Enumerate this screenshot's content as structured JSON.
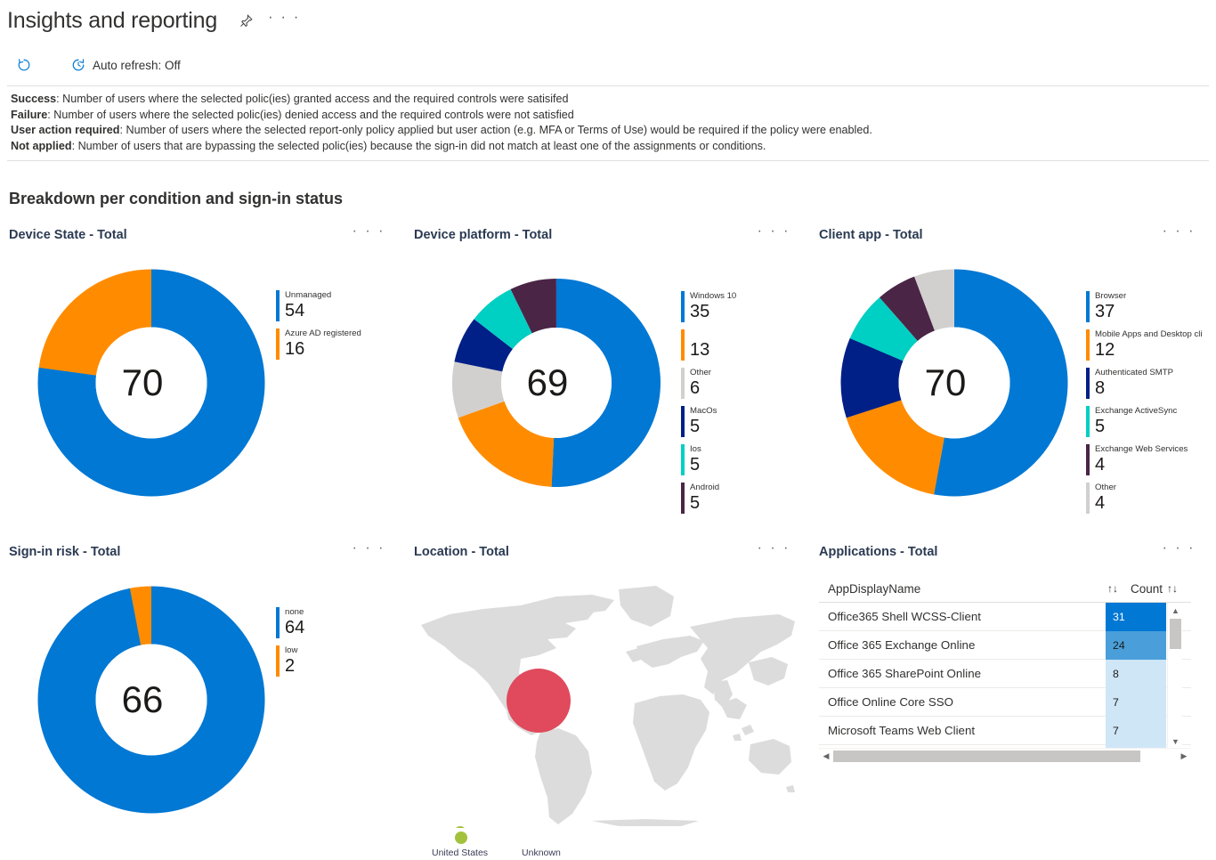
{
  "header": {
    "title": "Insights and reporting",
    "pin_icon": "pin-icon",
    "more_icon": "ellipsis-icon"
  },
  "commandbar": {
    "refresh_label": "",
    "refresh_icon": "refresh-icon",
    "auto_refresh_icon": "history-clock-icon",
    "auto_refresh_label": "Auto refresh: Off"
  },
  "description": [
    {
      "term": "Success",
      "text": ": Number of users where the selected polic(ies) granted access and the required controls were satisifed"
    },
    {
      "term": "Failure",
      "text": ": Number of users where the selected polic(ies) denied access and the required controls were not satisfied"
    },
    {
      "term": "User action required",
      "text": ": Number of users where the selected report-only policy applied but user action (e.g. MFA or Terms of Use) would be required if the policy were enabled."
    },
    {
      "term": "Not applied",
      "text": ": Number of users that are bypassing the selected polic(ies) because the sign-in did not match at least one of the assignments or conditions."
    }
  ],
  "section_heading": "Breakdown per condition and sign-in status",
  "more_menu_glyph": "· · ·",
  "chart_data": [
    {
      "type": "pie",
      "title": "Device State - Total",
      "center_total": "70",
      "legend_position": "right",
      "categories": [
        "Unmanaged",
        "Azure AD registered"
      ],
      "values": [
        54,
        16
      ],
      "colors": [
        "#0078d4",
        "#ff8c00"
      ],
      "labels": [
        "Unmanaged",
        "Azure AD registered"
      ]
    },
    {
      "type": "pie",
      "title": "Device platform - Total",
      "center_total": "69",
      "legend_position": "right",
      "categories": [
        "Windows 10",
        "",
        "Other",
        "MacOs",
        "Ios",
        "Android"
      ],
      "values": [
        35,
        13,
        6,
        5,
        5,
        5
      ],
      "colors": [
        "#0078d4",
        "#ff8c00",
        "#d2d0ce",
        "#002087",
        "#00cfc3",
        "#4a2545"
      ],
      "outer_colors": [
        "#0078d4",
        "#fbdcb4",
        "#eef0f2",
        "#b8c0da",
        "#b8ecec",
        "#d5ccd8"
      ],
      "labels": [
        "Windows 10",
        "",
        "Other",
        "MacOs",
        "Ios",
        "Android"
      ]
    },
    {
      "type": "pie",
      "title": "Client app - Total",
      "center_total": "70",
      "legend_position": "right",
      "categories": [
        "Browser",
        "Mobile Apps and Desktop cli",
        "Authenticated SMTP",
        "Exchange ActiveSync",
        "Exchange Web Services",
        "Other"
      ],
      "values": [
        37,
        12,
        8,
        5,
        4,
        4
      ],
      "colors": [
        "#0078d4",
        "#ff8c00",
        "#002087",
        "#00cfc3",
        "#4a2545",
        "#d2d0ce"
      ],
      "labels": [
        "Browser",
        "Mobile Apps and Desktop cli",
        "Authenticated SMTP",
        "Exchange ActiveSync",
        "Exchange Web Services",
        "Other"
      ]
    },
    {
      "type": "pie",
      "title": "Sign-in risk - Total",
      "center_total": "66",
      "legend_position": "right",
      "categories": [
        "none",
        "low"
      ],
      "values": [
        64,
        2
      ],
      "colors": [
        "#0078d4",
        "#ff8c00"
      ],
      "labels": [
        "none",
        "low"
      ]
    },
    {
      "type": "map",
      "title": "Location - Total",
      "legend_position": "bottom",
      "categories": [
        "United States",
        "Unknown"
      ],
      "colors": [
        "#e04a5c",
        "#a3c23c"
      ],
      "bubbles": [
        {
          "name": "United States",
          "color": "#e04a5c",
          "radius": 36
        },
        {
          "name": "Unknown",
          "color": "#a3c23c",
          "radius": 7
        }
      ]
    },
    {
      "type": "table",
      "title": "Applications - Total",
      "columns": [
        "AppDisplayName",
        "Count"
      ],
      "sort_glyph": "↑↓",
      "rows": [
        {
          "name": "Office365 Shell WCSS-Client",
          "count": "31",
          "bar_pct": 100
        },
        {
          "name": "Office 365 Exchange Online",
          "count": "24",
          "bar_pct": 77
        },
        {
          "name": "Office 365 SharePoint Online",
          "count": "8",
          "bar_pct": 26
        },
        {
          "name": "Office Online Core SSO",
          "count": "7",
          "bar_pct": 23
        },
        {
          "name": "Microsoft Teams Web Client",
          "count": "7",
          "bar_pct": 23
        }
      ]
    }
  ],
  "theme": {
    "accent": "#0078d4",
    "orange": "#ff8c00",
    "navy": "#002087",
    "teal": "#00cfc3",
    "plum": "#4a2545",
    "grey": "#d2d0ce",
    "text": "#323130"
  }
}
